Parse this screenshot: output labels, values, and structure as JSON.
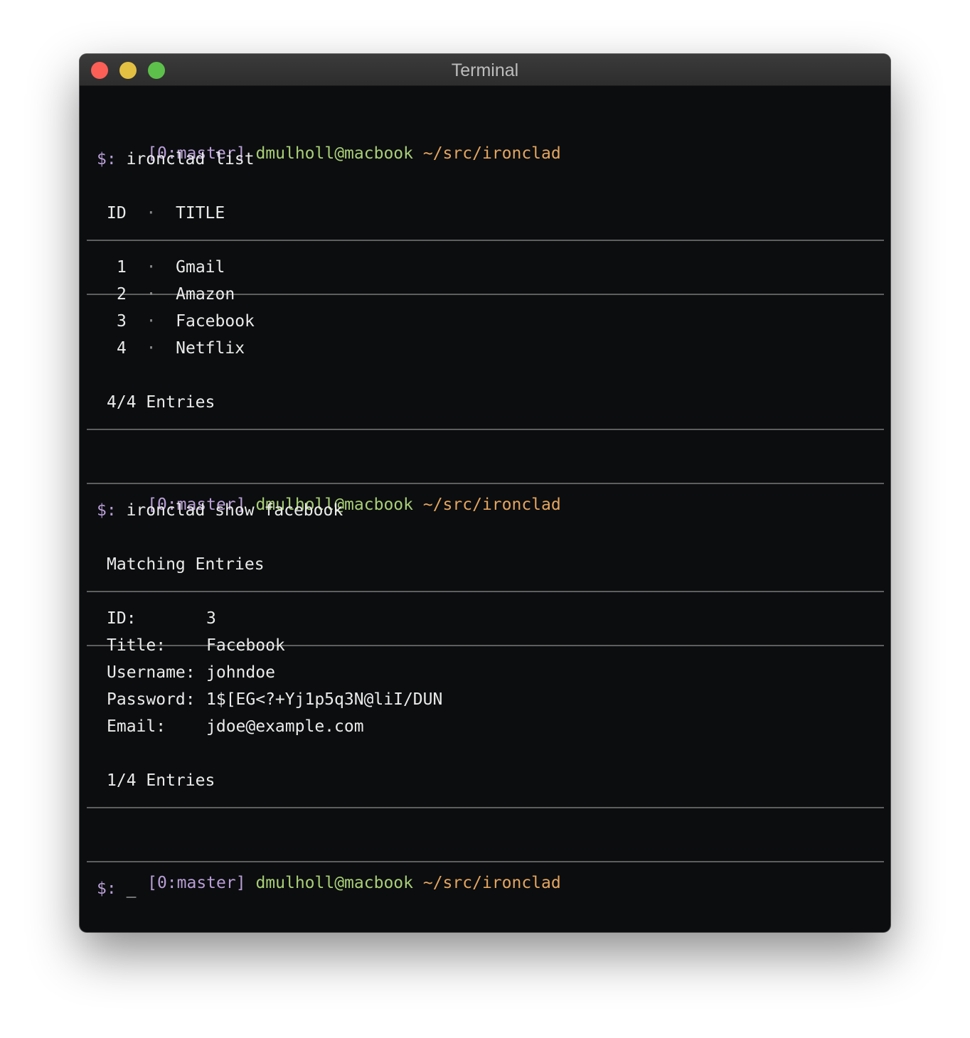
{
  "window": {
    "title": "Terminal"
  },
  "prompt": {
    "session": "[0:master]",
    "user_host": "dmulholl@macbook",
    "path": "~/src/ironclad",
    "symbol": "$:"
  },
  "commands": [
    "ironclad list",
    "ironclad show facebook"
  ],
  "list_output": {
    "header_id": "ID",
    "header_title": "TITLE",
    "separator": "·",
    "rows": [
      {
        "id": "1",
        "title": "Gmail"
      },
      {
        "id": "2",
        "title": "Amazon"
      },
      {
        "id": "3",
        "title": "Facebook"
      },
      {
        "id": "4",
        "title": "Netflix"
      }
    ],
    "footer": "4/4 Entries"
  },
  "show_output": {
    "header": "Matching Entries",
    "fields": [
      {
        "label": "ID:",
        "value": "3"
      },
      {
        "label": "Title:",
        "value": "Facebook"
      },
      {
        "label": "Username:",
        "value": "johndoe"
      },
      {
        "label": "Password:",
        "value": "1$[EG<?+Yj1p5q3N@liI/DUN"
      },
      {
        "label": "Email:",
        "value": "jdoe@example.com"
      }
    ],
    "footer": "1/4 Entries"
  },
  "cursor": "_"
}
